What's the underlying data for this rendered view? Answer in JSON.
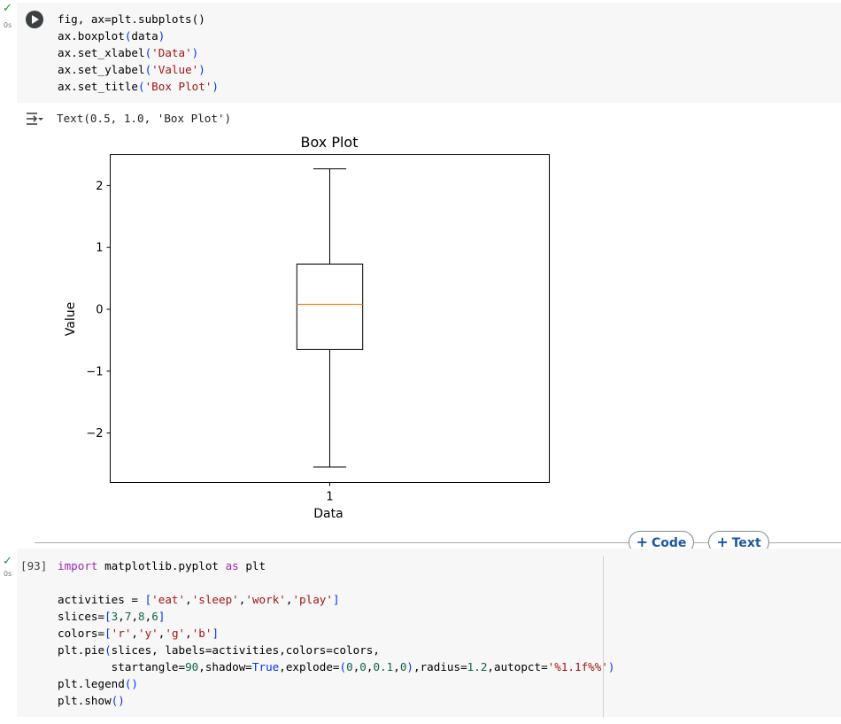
{
  "cell1": {
    "status_check": "✓",
    "exec_time": "0s",
    "code_lines": [
      "fig, ax=plt.subplots()",
      "ax.boxplot(data)",
      "ax.set_xlabel('Data')",
      "ax.set_ylabel('Value')",
      "ax.set_title('Box Plot')"
    ],
    "output_text": "Text(0.5, 1.0, 'Box Plot')"
  },
  "chart_data": {
    "type": "box",
    "title": "Box Plot",
    "xlabel": "Data",
    "ylabel": "Value",
    "categories": [
      "1"
    ],
    "boxes": [
      {
        "whisker_low": -2.55,
        "q1": -0.65,
        "median": 0.08,
        "q3": 0.73,
        "whisker_high": 2.27
      }
    ],
    "ylim": [
      -2.8,
      2.5
    ],
    "yticks": [
      -2,
      -1,
      0,
      1,
      2
    ],
    "ytick_labels": [
      "−2",
      "−1",
      "0",
      "1",
      "2"
    ],
    "grid": false,
    "colors": {
      "box": "#000000",
      "median": "#ff7f0e"
    }
  },
  "toolbar": {
    "add_code_label": "Code",
    "add_text_label": "Text"
  },
  "cell2": {
    "status_check": "✓",
    "exec_time": "0s",
    "execution_count": "[93]",
    "code_lines": [
      "import matplotlib.pyplot as plt",
      "",
      "activities = ['eat','sleep','work','play']",
      "slices=[3,7,8,6]",
      "colors=['r','y','g','b']",
      "plt.pie(slices, labels=activities,colors=colors,",
      "        startangle=90,shadow=True,explode=(0,0,0.1,0),radius=1.2,autopct='%1.1f%%')",
      "plt.legend()",
      "plt.show()"
    ]
  }
}
